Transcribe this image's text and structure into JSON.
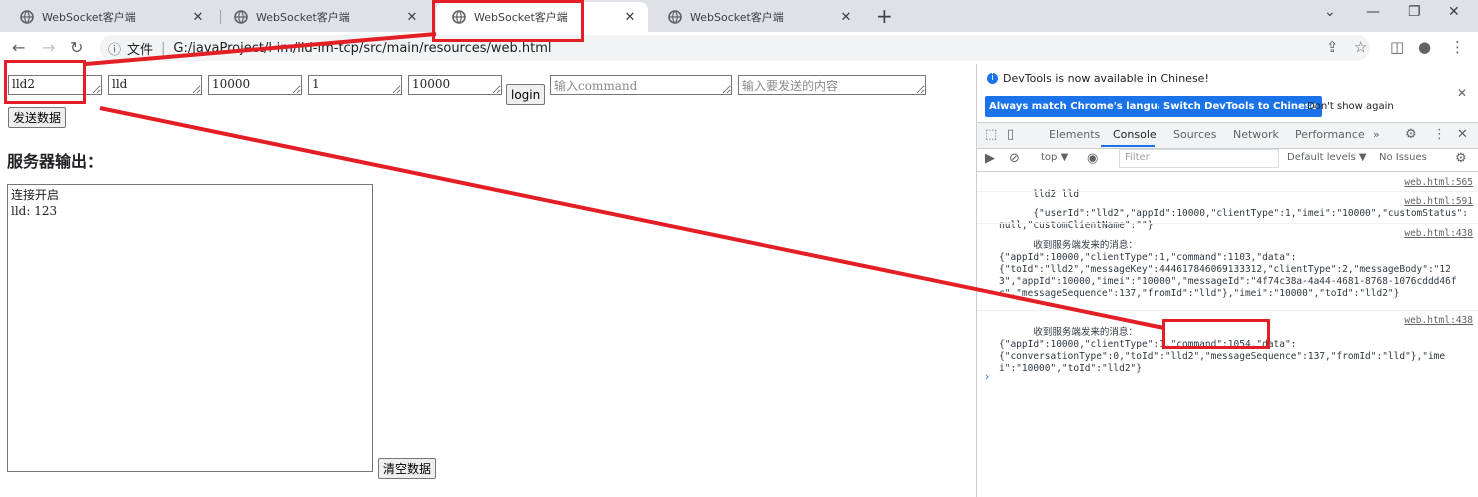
{
  "browser": {
    "tabs": [
      {
        "title": "WebSocket客户端",
        "active": false
      },
      {
        "title": "WebSocket客户端",
        "active": false
      },
      {
        "title": "WebSocket客户端",
        "active": true
      },
      {
        "title": "WebSocket客户端",
        "active": false
      }
    ],
    "address": {
      "scheme_label": "文件",
      "url": "G:/javaProject/l-im/lld-im-tcp/src/main/resources/web.html"
    }
  },
  "form": {
    "fields": [
      {
        "value": "lld2",
        "placeholder": ""
      },
      {
        "value": "lld",
        "placeholder": ""
      },
      {
        "value": "10000",
        "placeholder": ""
      },
      {
        "value": "1",
        "placeholder": ""
      },
      {
        "value": "10000",
        "placeholder": ""
      }
    ],
    "login_label": "login",
    "command_placeholder": "输入command",
    "content_placeholder": "输入要发送的内容",
    "send_label": "发送数据",
    "output_heading": "服务器输出：",
    "output_text": "连接开启\nlld: 123",
    "clear_label": "清空数据"
  },
  "devtools": {
    "notice": "DevTools is now available in Chinese!",
    "btn_match": "Always match Chrome's language",
    "btn_switch": "Switch DevTools to Chinese",
    "btn_dont": "Don't show again",
    "tabs": [
      "Elements",
      "Console",
      "Sources",
      "Network",
      "Performance",
      "»"
    ],
    "context": "top ▼",
    "filter_placeholder": "Filter",
    "levels": "Default levels ▼",
    "issues": "No Issues",
    "messages": [
      {
        "text": "lld2 lld",
        "source": "web.html:565"
      },
      {
        "text": "{\"userId\":\"lld2\",\"appId\":10000,\"clientType\":1,\"imei\":\"10000\",\"customStatus\":null,\"customClientName\":\"\"}",
        "source": "web.html:591"
      },
      {
        "text": "收到服务端发来的消息：\n{\"appId\":10000,\"clientType\":1,\"command\":1103,\"data\":\n{\"toId\":\"lld2\",\"messageKey\":444617846069133312,\"clientType\":2,\"messageBody\":\"123\",\"appId\":10000,\"imei\":\"10000\",\"messageId\":\"4f74c38a-4a44-4681-8768-1076cddd46fc\",\"messageSequence\":137,\"fromId\":\"lld\"},\"imei\":\"10000\",\"toId\":\"lld2\"}",
        "source": "web.html:438"
      },
      {
        "text": "收到服务端发来的消息：\n{\"appId\":10000,\"clientType\":1,\"command\":1054,\"data\":\n{\"conversationType\":0,\"toId\":\"lld2\",\"messageSequence\":137,\"fromId\":\"lld\"},\"imei\":\"10000\",\"toId\":\"lld2\"}",
        "source": "web.html:438"
      }
    ],
    "prompt": "›"
  },
  "annotation_color": "#e31e24"
}
